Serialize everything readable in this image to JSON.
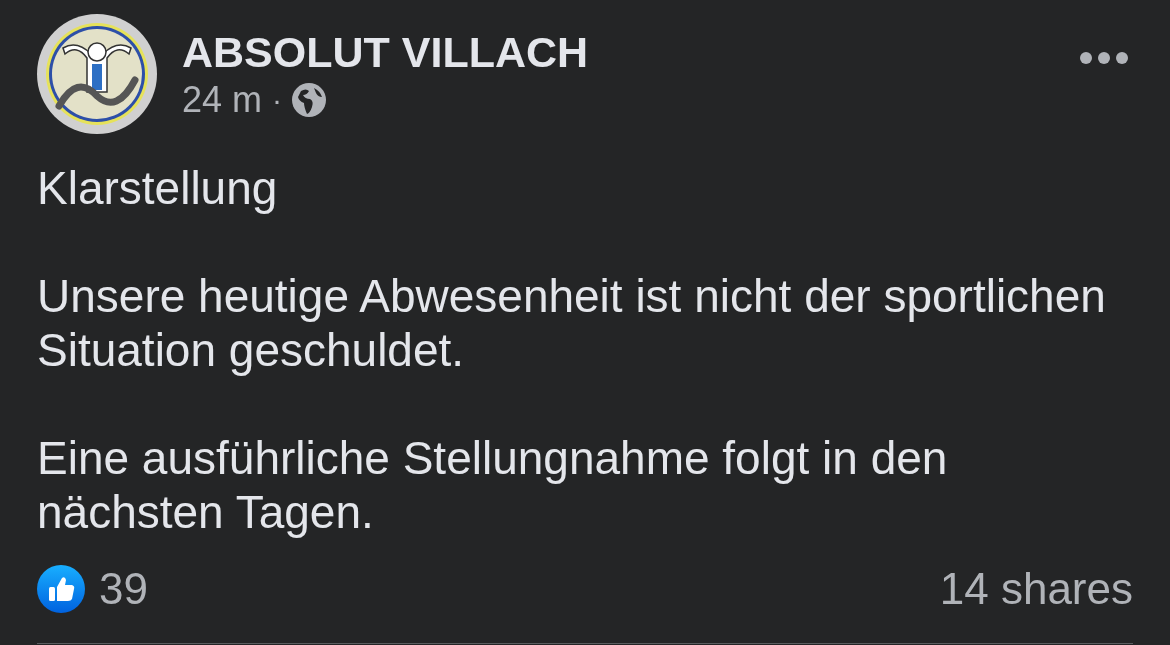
{
  "post": {
    "author": "ABSOLUT VILLACH",
    "time": "24 m",
    "separator": "·",
    "paragraphs": [
      "Klarstellung",
      "Unsere heutige Abwesenheit ist nicht der sportlichen Situation geschuldet.",
      "Eine ausführliche Stellungnahme folgt in den nächsten Tagen."
    ],
    "reactions": {
      "count": "39"
    },
    "shares": "14 shares"
  }
}
